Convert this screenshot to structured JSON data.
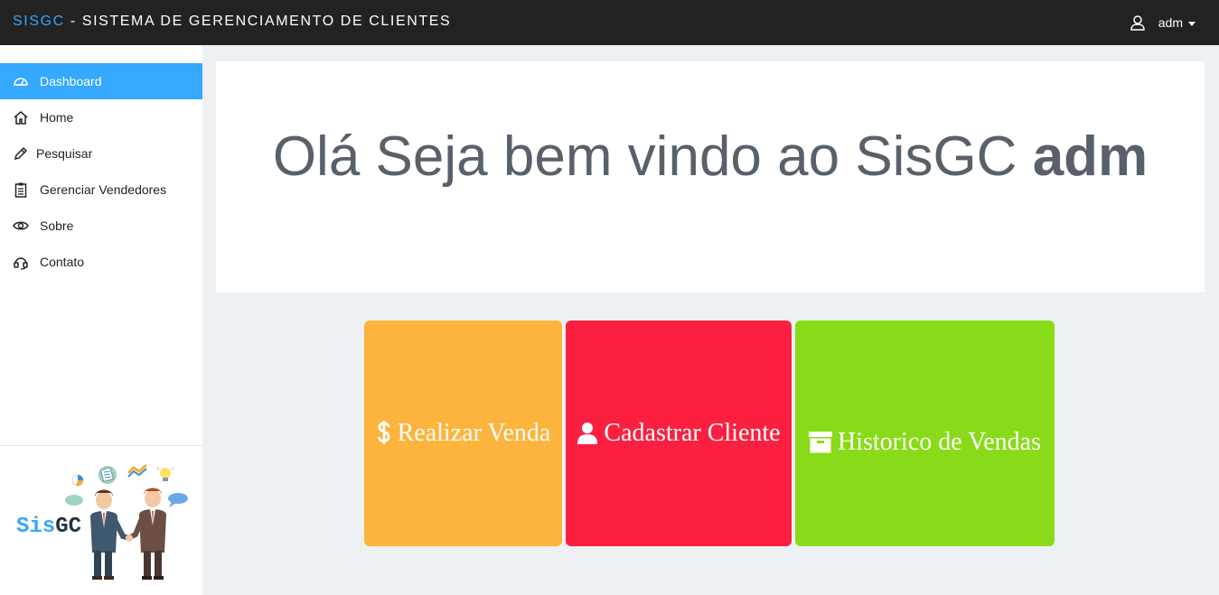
{
  "header": {
    "brand_short": "SISGC",
    "brand_rest": " - SISTEMA DE GERENCIAMENTO DE CLIENTES",
    "user_icon": "user-outline-icon",
    "user_name": "adm"
  },
  "sidebar": {
    "items": [
      {
        "label": "Dashboard",
        "icon": "dashboard-gauge-icon",
        "active": true
      },
      {
        "label": "Home",
        "icon": "home-icon",
        "active": false
      },
      {
        "label": "Pesquisar",
        "icon": "pencil-icon",
        "active": false
      },
      {
        "label": "Gerenciar Vendedores",
        "icon": "clipboard-list-icon",
        "active": false
      },
      {
        "label": "Sobre",
        "icon": "eye-icon",
        "active": false
      },
      {
        "label": "Contato",
        "icon": "headset-icon",
        "active": false
      }
    ],
    "logo_text": "SisGC"
  },
  "main": {
    "welcome_prefix": "Olá Seja bem vindo ao SisGC",
    "welcome_user": "adm",
    "tiles": [
      {
        "label": "Realizar Venda",
        "icon": "dollar-icon",
        "color": "#fdb43c"
      },
      {
        "label": "Cadastrar Cliente",
        "icon": "user-icon",
        "color": "#fb2040"
      },
      {
        "label": "Historico de Vendas",
        "icon": "archive-box-icon",
        "color": "#89db19"
      }
    ]
  },
  "colors": {
    "accent": "#35a8ff",
    "topbar": "#222222",
    "background": "#eef1f4"
  }
}
